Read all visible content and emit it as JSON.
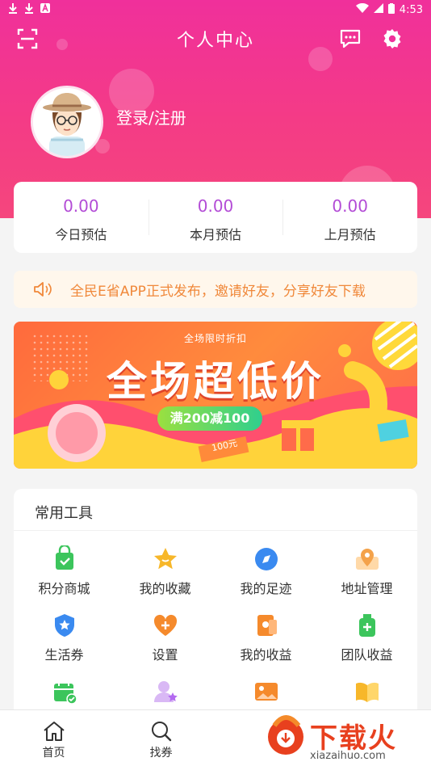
{
  "status_bar": {
    "time": "4:53"
  },
  "header": {
    "title": "个人中心",
    "login_label": "登录/注册"
  },
  "stats": [
    {
      "value": "0.00",
      "label": "今日预估"
    },
    {
      "value": "0.00",
      "label": "本月预估"
    },
    {
      "value": "0.00",
      "label": "上月预估"
    }
  ],
  "notice": {
    "text": "全民E省APP正式发布，邀请好友，分享好友下载"
  },
  "banner": {
    "subtitle": "全场限时折扣",
    "headline": "全场超低价",
    "badge": "满200减100",
    "coupon": "100元"
  },
  "tools": {
    "title": "常用工具",
    "items": [
      {
        "label": "积分商城",
        "icon": "shopping-bag-icon",
        "color": "#3cc55c"
      },
      {
        "label": "我的收藏",
        "icon": "star-icon",
        "color": "#f7b72a"
      },
      {
        "label": "我的足迹",
        "icon": "compass-icon",
        "color": "#3a8af0"
      },
      {
        "label": "地址管理",
        "icon": "map-pin-icon",
        "color": "#f4a24a"
      },
      {
        "label": "生活券",
        "icon": "shield-star-icon",
        "color": "#3a8af0"
      },
      {
        "label": "设置",
        "icon": "heart-plus-icon",
        "color": "#f58a2c"
      },
      {
        "label": "我的收益",
        "icon": "wallet-icon",
        "color": "#f58a2c"
      },
      {
        "label": "团队收益",
        "icon": "bottle-plus-icon",
        "color": "#3cc55c"
      },
      {
        "label": "",
        "icon": "calendar-check-icon",
        "color": "#3cc55c"
      },
      {
        "label": "",
        "icon": "user-star-icon",
        "color": "#b36af0"
      },
      {
        "label": "",
        "icon": "image-icon",
        "color": "#f58a2c"
      },
      {
        "label": "",
        "icon": "book-icon",
        "color": "#f7b72a"
      }
    ]
  },
  "tabbar": [
    {
      "label": "首页",
      "icon": "home-icon"
    },
    {
      "label": "找券",
      "icon": "search-icon"
    }
  ],
  "watermark": {
    "text": "下载火",
    "url": "xiazaihuo.com"
  }
}
